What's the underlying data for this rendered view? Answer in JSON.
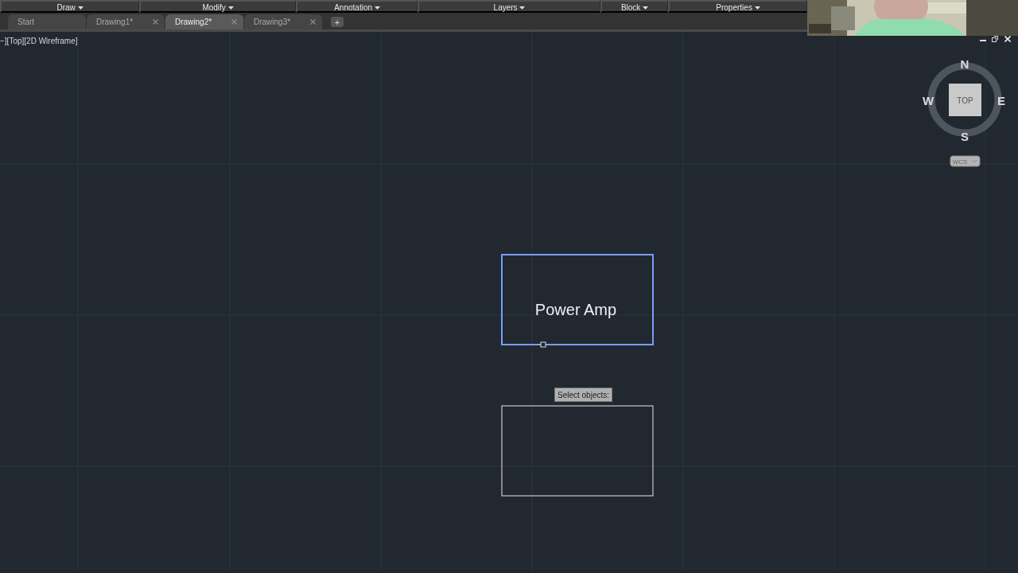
{
  "ribbon_panels": [
    {
      "label": "Draw"
    },
    {
      "label": "Modify"
    },
    {
      "label": "Annotation"
    },
    {
      "label": "Layers"
    },
    {
      "label": "Block"
    },
    {
      "label": "Properties"
    }
  ],
  "tabs": [
    {
      "label": "Start",
      "selected": false,
      "closable": false
    },
    {
      "label": "Drawing1*",
      "selected": false,
      "closable": true
    },
    {
      "label": "Drawing2*",
      "selected": true,
      "closable": true
    },
    {
      "label": "Drawing3*",
      "selected": false,
      "closable": true
    }
  ],
  "new_tab": "+",
  "viewport_label": "−][Top][2D Wireframe]",
  "viewcube": {
    "face": "TOP",
    "north": "N",
    "south": "S",
    "east": "E",
    "west": "W",
    "ucs": "WCS"
  },
  "blocks": [
    {
      "label": "Power Amp",
      "selected": true
    },
    {
      "selected": false
    }
  ],
  "tooltip": "Select objects:"
}
